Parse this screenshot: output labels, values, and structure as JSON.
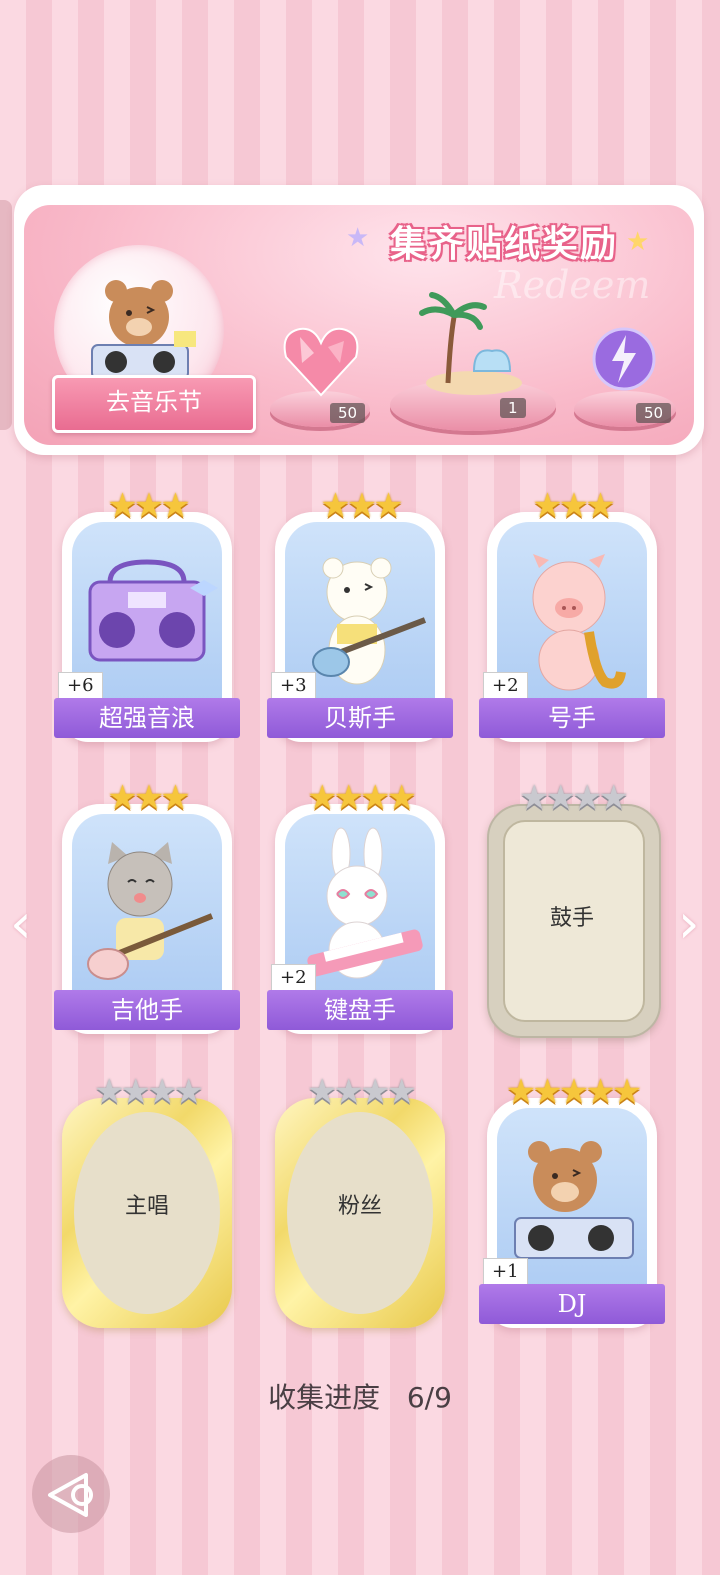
{
  "reward_panel": {
    "title": "集齐贴纸奖励",
    "watermark": "Redeem",
    "go_button_label": "去音乐节",
    "rewards": [
      {
        "name": "heart-gem-icon",
        "count": "50"
      },
      {
        "name": "palm-island-icon",
        "count": "1"
      },
      {
        "name": "energy-orb-icon",
        "count": "50"
      }
    ]
  },
  "stickers": [
    {
      "label": "超强音浪",
      "bonus": "+6",
      "stars": 3,
      "state": "collected",
      "icon": "boombox-icon"
    },
    {
      "label": "贝斯手",
      "bonus": "+3",
      "stars": 3,
      "state": "collected",
      "icon": "bear-bassist-icon"
    },
    {
      "label": "号手",
      "bonus": "+2",
      "stars": 3,
      "state": "collected",
      "icon": "pig-saxophone-icon"
    },
    {
      "label": "吉他手",
      "bonus": "",
      "stars": 3,
      "state": "collected",
      "icon": "cat-guitar-icon"
    },
    {
      "label": "键盘手",
      "bonus": "+2",
      "stars": 4,
      "state": "collected",
      "icon": "bunny-keytar-icon"
    },
    {
      "label": "鼓手",
      "bonus": "",
      "stars": 4,
      "state": "locked",
      "icon": ""
    },
    {
      "label": "主唱",
      "bonus": "",
      "stars": 4,
      "state": "locked-gold",
      "icon": ""
    },
    {
      "label": "粉丝",
      "bonus": "",
      "stars": 4,
      "state": "locked-gold",
      "icon": ""
    },
    {
      "label": "DJ",
      "bonus": "+1",
      "stars": 5,
      "state": "collected",
      "icon": "bear-dj-icon"
    }
  ],
  "progress": {
    "label": "收集进度",
    "value": "6/9"
  },
  "colors": {
    "ribbon": "#9b66e0",
    "title_outline": "#e8638a",
    "star_gold": "#f6c63c",
    "star_gray": "#c9c9cf"
  }
}
